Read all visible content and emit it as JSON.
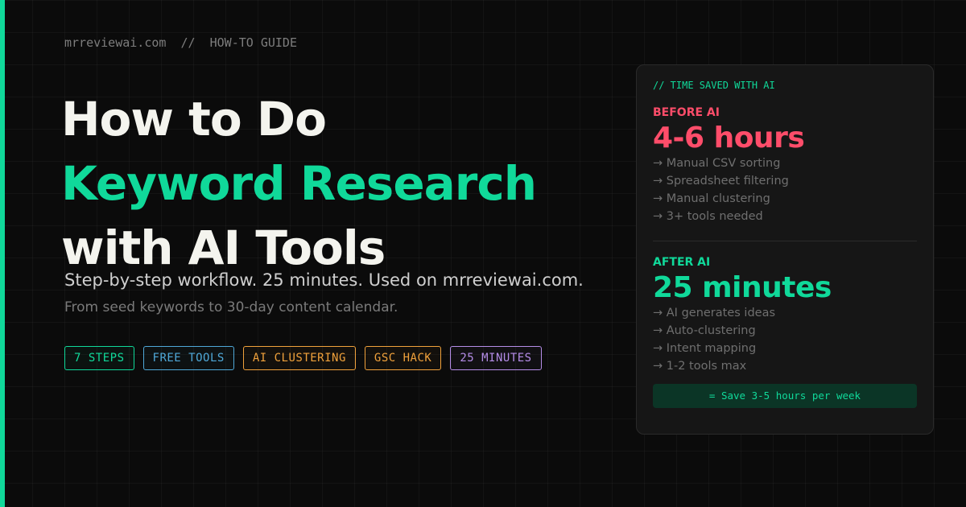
{
  "header": {
    "site": "mrreviewai.com",
    "separator": "//",
    "category": "HOW-TO GUIDE"
  },
  "title": {
    "line1": "How to Do",
    "line2": "Keyword Research",
    "line3": "with AI Tools"
  },
  "subtitle": "Step-by-step workflow. 25 minutes. Used on mrreviewai.com.",
  "subline": "From seed keywords to 30-day content calendar.",
  "tags": [
    {
      "label": "7 STEPS",
      "color": "#10d99a"
    },
    {
      "label": "FREE TOOLS",
      "color": "#4fa8d8"
    },
    {
      "label": "AI CLUSTERING",
      "color": "#f0a13b"
    },
    {
      "label": "GSC HACK",
      "color": "#f0a13b"
    },
    {
      "label": "25 MINUTES",
      "color": "#b58de8"
    }
  ],
  "card": {
    "label": "// TIME SAVED WITH AI",
    "before": {
      "label": "BEFORE AI",
      "value": "4-6 hours",
      "items": [
        "→ Manual CSV sorting",
        "→ Spreadsheet filtering",
        "→ Manual clustering",
        "→ 3+ tools needed"
      ]
    },
    "after": {
      "label": "AFTER AI",
      "value": "25 minutes",
      "items": [
        "→ AI generates ideas",
        "→ Auto-clustering",
        "→ Intent mapping",
        "→ 1-2 tools max"
      ]
    },
    "savings": "= Save 3-5 hours per week"
  },
  "colors": {
    "accent": "#10d99a",
    "danger": "#ff4d6a",
    "background": "#0b0b0b"
  }
}
